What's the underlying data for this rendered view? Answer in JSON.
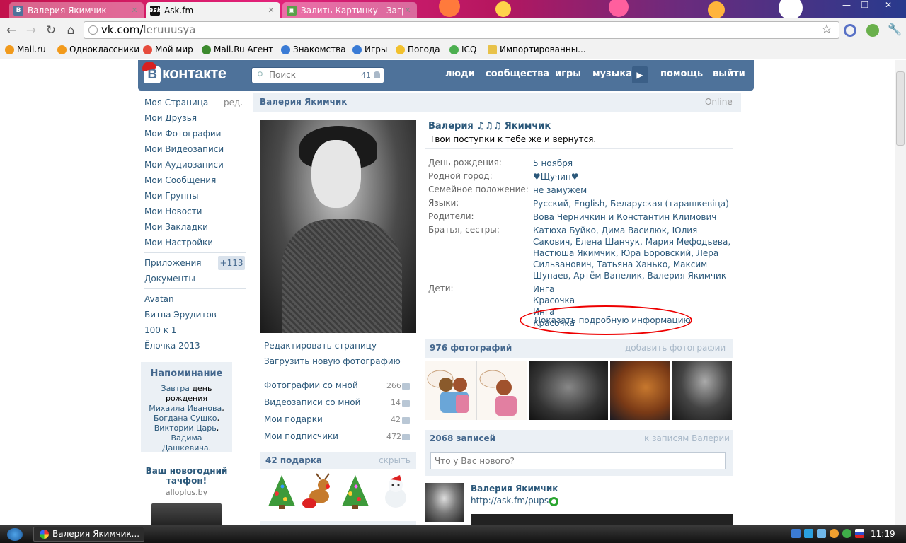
{
  "browser": {
    "tabs": [
      {
        "label": "Валерия Якимчик",
        "icon": "vk-icon",
        "active": false
      },
      {
        "label": "Ask.fm",
        "icon": "askfm-icon",
        "active": true
      },
      {
        "label": "Залить Картинку - Загру:",
        "icon": "image-host-icon",
        "active": false
      }
    ],
    "url_domain": "vk.com/",
    "url_path": "leruuusya",
    "bookmarks": [
      "Mail.ru",
      "Одноклассники",
      "Мой мир",
      "Mail.Ru Агент",
      "Знакомства",
      "Игры",
      "Погода",
      "ICQ",
      "Импортированны..."
    ]
  },
  "vk": {
    "logo": "контакте",
    "logo_letter": "В",
    "search_placeholder": "Поиск",
    "search_count": "41",
    "nav": [
      "люди",
      "сообщества",
      "игры",
      "музыка",
      "помощь",
      "выйти"
    ],
    "left_menu": {
      "edit": "ред.",
      "main": [
        "Моя Страница",
        "Мои Друзья",
        "Мои Фотографии",
        "Мои Видеозаписи",
        "Мои Аудиозаписи",
        "Мои Сообщения",
        "Мои Группы",
        "Мои Новости",
        "Мои Закладки",
        "Мои Настройки"
      ],
      "apps": "Приложения",
      "apps_count": "+113",
      "docs": "Документы",
      "games": [
        "Avatan",
        "Битва Эрудитов",
        "100 к 1",
        "Ёлочка 2013"
      ]
    },
    "reminder": {
      "title": "Напоминание",
      "t1": "Завтра",
      "t2": " день рождения ",
      "n1": "Михаила Иванова",
      "n2": "Богдана Сушко",
      "n3": "Виктории Царь",
      "n4": "Вадима Дашкевича",
      "comma": ", ",
      "dot": "."
    },
    "ad": {
      "title": "Ваш новогодний тачфон!",
      "site": "alloplus.by"
    }
  },
  "profile": {
    "header_name": "Валерия Якимчик",
    "online": "Online",
    "name": "Валерия ♫♫♫ Якимчик",
    "status": "Твои поступки к тебе же и вернутся.",
    "actions": [
      "Редактировать страницу",
      "Загрузить новую фотографию"
    ],
    "links": [
      {
        "label": "Фотографии со мной",
        "count": "266"
      },
      {
        "label": "Видеозаписи со мной",
        "count": "14"
      },
      {
        "label": "Мои подарки",
        "count": "42"
      },
      {
        "label": "Мои подписчики",
        "count": "472"
      }
    ],
    "gifts_title": "42 подарка",
    "gifts_hide": "скрыть",
    "info": [
      {
        "label": "День рождения:",
        "value": "5 ноября"
      },
      {
        "label": "Родной город:",
        "value": "♥Щучин♥"
      },
      {
        "label": "Семейное положение:",
        "value": "не замужем"
      },
      {
        "label": "Языки:",
        "value": "Русский, English, Беларуская (тарашкевіца)"
      },
      {
        "label": "Родители:",
        "value": "Вова Черничкин и Константин Климович"
      },
      {
        "label": "Братья, сестры:",
        "value": "Катюха Буйко, Дима Василюк, Юлия Сакович, Елена Шанчук, Мария Мефодьева, Настюша Якимчик, Юра Боровский, Лера Сильванович, Татьяна Ханько, Максим Шупаев, Артём Ванелик, Валерия Якимчик"
      },
      {
        "label": "Дети:",
        "value": "Инга Красочка Инга Красочка"
      }
    ],
    "more_info": "Показать подробную информацию",
    "photos_title": "976 фотографий",
    "photos_add": "добавить фотографии",
    "wall_title": "2068 записей",
    "wall_to": "к записям Валерии",
    "wall_placeholder": "Что у Вас нового?",
    "post_author": "Валерия Якимчик",
    "post_link": "http://ask.fm/pupss"
  },
  "taskbar": {
    "task": "Валерия Якимчик...",
    "clock": "11:19"
  },
  "colors": {
    "vk_blue": "#4e729a",
    "link": "#2b587a",
    "panel": "#ebf0f5",
    "highlight": "#e00000"
  }
}
